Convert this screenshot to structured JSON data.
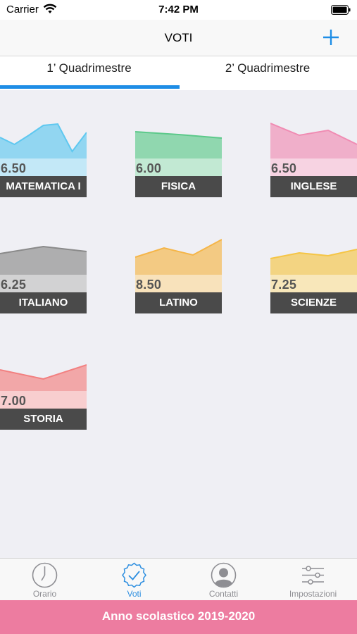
{
  "status": {
    "carrier": "Carrier",
    "time": "7:42 PM"
  },
  "nav": {
    "title": "VOTI",
    "add_icon": "plus-icon"
  },
  "tabs": [
    {
      "label": "1’ Quadrimestre",
      "selected": true
    },
    {
      "label": "2’ Quadrimestre",
      "selected": false
    }
  ],
  "subjects": [
    {
      "name": "MATEMATICA I",
      "grade": "6.50",
      "color": "#5fc8f0",
      "trend": [
        0.55,
        0.45,
        0.58,
        0.72,
        0.74,
        0.35,
        0.62
      ]
    },
    {
      "name": "FISICA",
      "grade": "6.00",
      "color": "#5cc98a",
      "trend": [
        0.63,
        0.59,
        0.54
      ]
    },
    {
      "name": "INGLESE",
      "grade": "6.50",
      "color": "#f08cb3",
      "trend": [
        0.75,
        0.58,
        0.65,
        0.45
      ]
    },
    {
      "name": "ITALIANO",
      "grade": "6.25",
      "color": "#8a8a8a",
      "trend": [
        0.55,
        0.65,
        0.58
      ]
    },
    {
      "name": "LATINO",
      "grade": "8.50",
      "color": "#f5b547",
      "trend": [
        0.5,
        0.63,
        0.53,
        0.75
      ]
    },
    {
      "name": "SCIENZE",
      "grade": "7.25",
      "color": "#f5c545",
      "trend": [
        0.48,
        0.56,
        0.52,
        0.61
      ]
    },
    {
      "name": "STORIA",
      "grade": "7.00",
      "color": "#f28080",
      "trend": [
        0.55,
        0.42,
        0.62
      ]
    }
  ],
  "tabbar": [
    {
      "label": "Orario",
      "icon": "clock-icon",
      "active": false
    },
    {
      "label": "Voti",
      "icon": "check-badge-icon",
      "active": true
    },
    {
      "label": "Contatti",
      "icon": "contact-icon",
      "active": false
    },
    {
      "label": "Impostazioni",
      "icon": "sliders-icon",
      "active": false
    }
  ],
  "footer": {
    "text": "Anno scolastico 2019-2020"
  }
}
